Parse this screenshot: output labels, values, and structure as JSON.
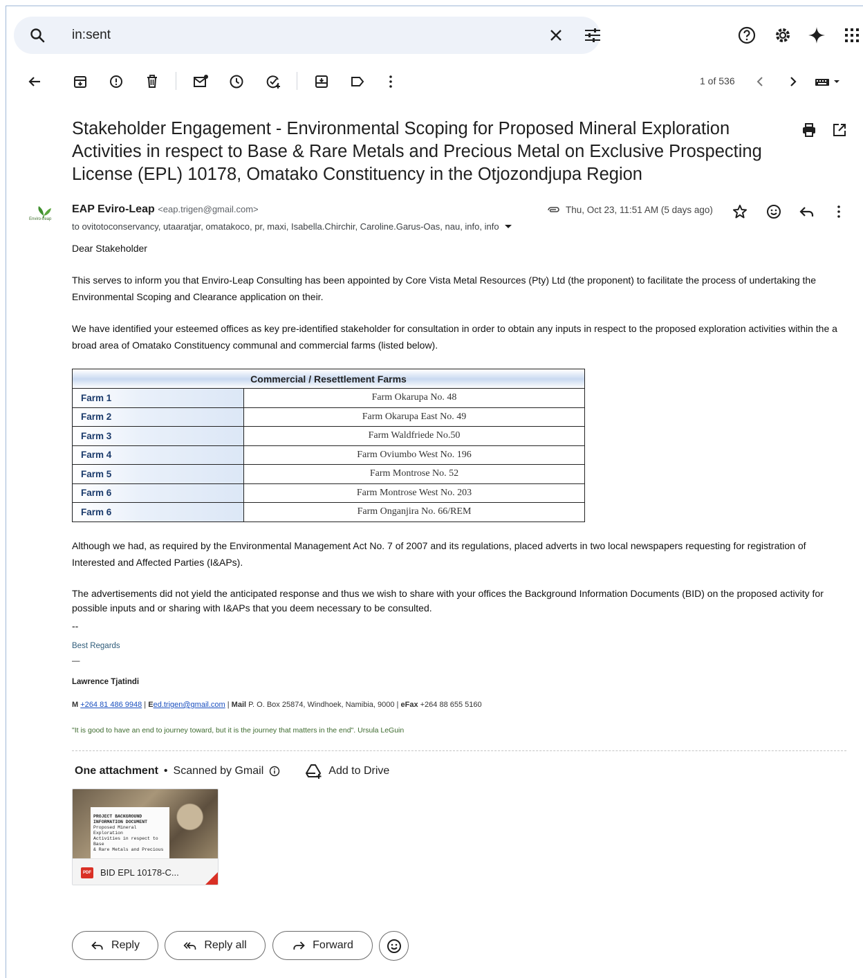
{
  "search": {
    "query": "in:sent"
  },
  "toolbar": {
    "pager": "1 of 536"
  },
  "email": {
    "subject": "Stakeholder Engagement - Environmental Scoping for Proposed Mineral Exploration Activities in respect to Base & Rare Metals and Precious Metal on Exclusive Prospecting License (EPL) 10178, Omatako Constituency in the Otjozondjupa Region",
    "sender_name": "EAP Eviro-Leap",
    "sender_email": "<eap.trigen@gmail.com>",
    "recipients": "to ovitotoconservancy, utaaratjar, omatakoco, pr, maxi, Isabella.Chirchir, Caroline.Garus-Oas, nau, info, info",
    "date": "Thu, Oct 23, 11:51 AM (5 days ago)",
    "avatar_text": "Enviro-Leap",
    "greeting": "Dear Stakeholder",
    "para1": "This serves to inform you that Enviro-Leap Consulting has been appointed by Core Vista Metal Resources (Pty) Ltd (the proponent) to facilitate the process of undertaking the Environmental Scoping and Clearance application on their.",
    "para2": "We have identified your esteemed offices as key pre-identified stakeholder for consultation in order to obtain any inputs in respect to the proposed exploration activities within the a broad area of Omatako Constituency communal and commercial farms (listed below).",
    "para3": "Although we had, as required by the Environmental Management Act No. 7 of 2007 and its regulations,  placed adverts in two local newspapers requesting for registration of Interested and Affected Parties (I&APs).",
    "para4": "The advertisements did not yield the anticipated response and thus we wish to share with your offices the Background Information Documents (BID) on the proposed activity for possible inputs and or sharing with I&APs that you deem necessary to be consulted.",
    "sig_sep": "--"
  },
  "farm_table": {
    "header": "Commercial / Resettlement Farms",
    "rows": [
      {
        "label": "Farm 1",
        "value": "Farm Okarupa No. 48"
      },
      {
        "label": "Farm 2",
        "value": "Farm Okarupa East No. 49"
      },
      {
        "label": "Farm 3",
        "value": "Farm Waldfriede No.50"
      },
      {
        "label": "Farm 4",
        "value": "Farm Oviumbo West No. 196"
      },
      {
        "label": "Farm 5",
        "value": "Farm Montrose No. 52"
      },
      {
        "label": "Farm 6",
        "value": "Farm Montrose West No. 203"
      },
      {
        "label": "Farm 6",
        "value": "Farm Onganjira No. 66/REM"
      }
    ]
  },
  "signature": {
    "regards": "Best Regards",
    "dash": "—",
    "name": "Lawrence Tjatindi",
    "m_label": "M",
    "mobile": "+264 81 486 9948",
    "pipe1": " | ",
    "e_label": "E",
    "email": "ed.trigen@gmail.com",
    "pipe2": " | ",
    "mail_label": "Mail",
    "address": " P. O. Box 25874,   Windhoek, Namibia, 9000 | ",
    "fax_label": "eFax",
    "fax": " +264 88 655 5160",
    "quote": "\"It is good to have an end to journey toward, but it is the journey that matters in the end\".  Ursula LeGuin"
  },
  "attachments": {
    "title": "One attachment",
    "dot": "•",
    "scanned": "Scanned by Gmail",
    "add_drive": "Add to Drive",
    "file_name": "BID EPL 10178-C...",
    "file_badge": "PDF",
    "thumb_lines": [
      "PROJECT BACKGROUND",
      "INFORMATION DOCUMENT",
      "Proposed Mineral Exploration",
      "Activities in respect to Base",
      "& Rare Metals and Precious"
    ]
  },
  "actions": {
    "reply": "Reply",
    "reply_all": "Reply all",
    "forward": "Forward"
  }
}
